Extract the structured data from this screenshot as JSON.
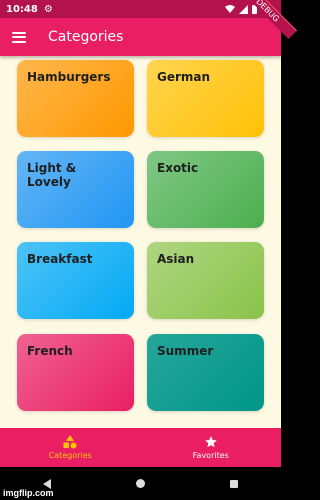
{
  "status": {
    "time": "10:48",
    "settings_glyph": "⚙"
  },
  "debug_banner": "DEBUG",
  "app_bar": {
    "title": "Categories"
  },
  "categories": [
    {
      "label": "Hamburgers",
      "color_from": "#ffb74d",
      "color_to": "#ff9800"
    },
    {
      "label": "German",
      "color_from": "#ffd54f",
      "color_to": "#ffc107"
    },
    {
      "label": "Light & Lovely",
      "color_from": "#64b5f6",
      "color_to": "#2196f3"
    },
    {
      "label": "Exotic",
      "color_from": "#81c784",
      "color_to": "#4caf50"
    },
    {
      "label": "Breakfast",
      "color_from": "#4fc3f7",
      "color_to": "#03a9f4"
    },
    {
      "label": "Asian",
      "color_from": "#aed581",
      "color_to": "#8bc34a"
    },
    {
      "label": "French",
      "color_from": "#f06292",
      "color_to": "#e91e63"
    },
    {
      "label": "Summer",
      "color_from": "#26a69a",
      "color_to": "#009688"
    }
  ],
  "bottom_nav": {
    "items": [
      {
        "label": "Categories",
        "icon": "category-icon",
        "active": true
      },
      {
        "label": "Favorites",
        "icon": "star-icon",
        "active": false
      }
    ]
  },
  "watermark": "imgflip.com",
  "colors": {
    "primary": "#e91e63",
    "accent": "#ffc107",
    "background": "#fdf9e3"
  }
}
